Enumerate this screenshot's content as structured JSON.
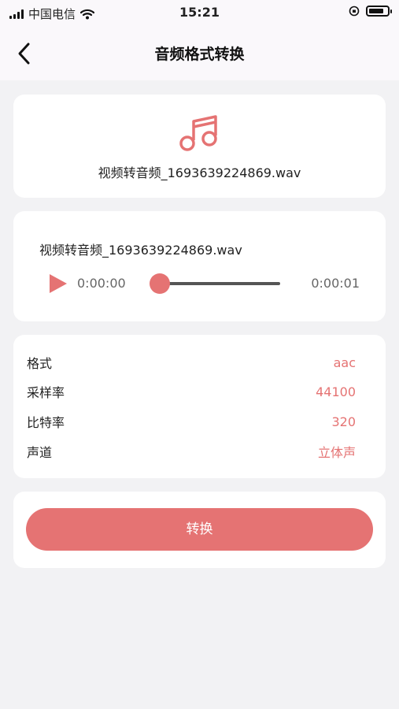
{
  "status_bar": {
    "carrier": "中国电信",
    "time": "15:21",
    "battery_level": 0.8
  },
  "header": {
    "title": "音频格式转换",
    "back_icon": "chevron-left-icon"
  },
  "file_card": {
    "icon": "music-note-icon",
    "file_name": "视频转音频_1693639224869.wav"
  },
  "player": {
    "file_name": "视频转音频_1693639224869.wav",
    "current_time": "0:00:00",
    "total_time": "0:00:01",
    "progress": 0,
    "play_icon": "play-icon"
  },
  "settings": [
    {
      "label": "格式",
      "value": "aac"
    },
    {
      "label": "采样率",
      "value": "44100"
    },
    {
      "label": "比特率",
      "value": "320"
    },
    {
      "label": "声道",
      "value": "立体声"
    }
  ],
  "action": {
    "convert_label": "转换"
  },
  "colors": {
    "accent": "#e57373",
    "background": "#f2f2f4",
    "card": "#ffffff"
  }
}
